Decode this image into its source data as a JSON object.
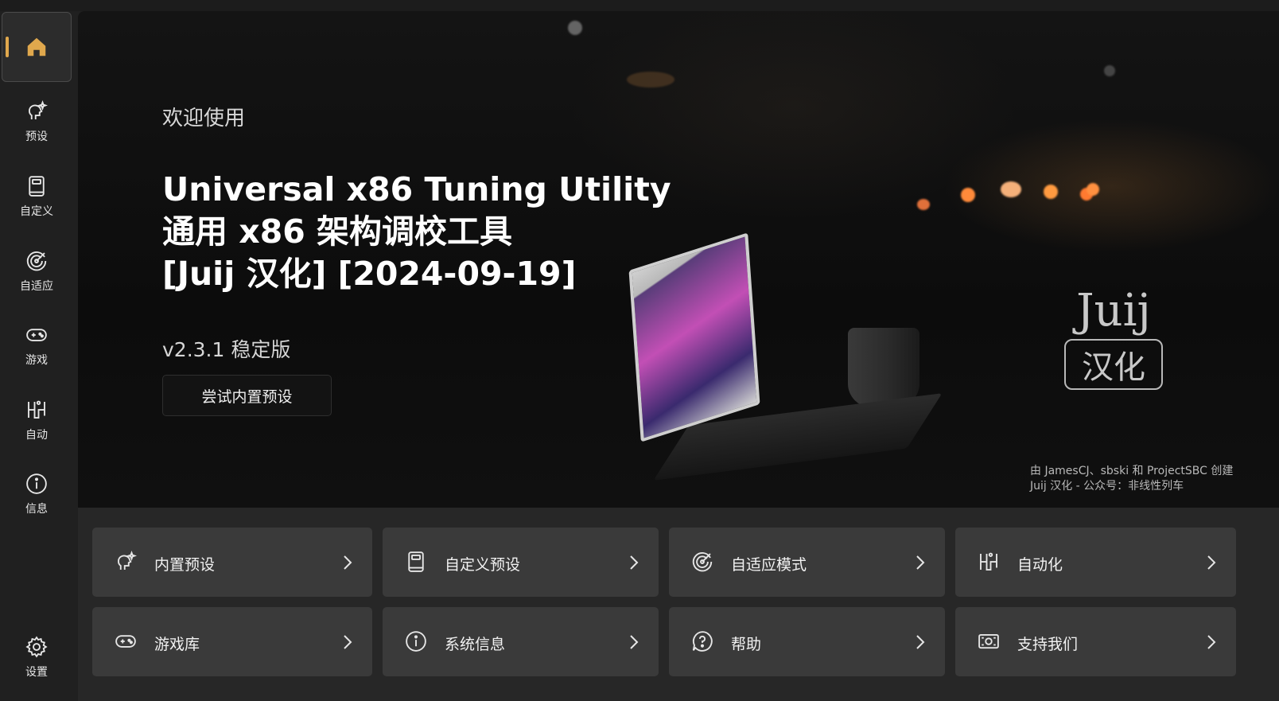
{
  "sidebar": {
    "items": [
      {
        "label": "",
        "icon": "home-icon",
        "active": true
      },
      {
        "label": "预设",
        "icon": "preset-icon"
      },
      {
        "label": "自定义",
        "icon": "book-icon"
      },
      {
        "label": "自适应",
        "icon": "adaptive-icon"
      },
      {
        "label": "游戏",
        "icon": "gamepad-icon"
      },
      {
        "label": "自动",
        "icon": "automation-icon"
      },
      {
        "label": "信息",
        "icon": "info-icon"
      }
    ],
    "settings": {
      "label": "设置",
      "icon": "gear-icon"
    }
  },
  "hero": {
    "welcome": "欢迎使用",
    "title_line1": "Universal x86 Tuning Utility",
    "title_line2": "通用 x86 架构调校工具",
    "title_line3": "[Juij 汉化] [2024-09-19]",
    "version": "v2.3.1 稳定版",
    "try_button": "尝试内置预设",
    "credits_line1": "由 JamesCJ、sbski 和 ProjectSBC 创建",
    "credits_line2": "Juij 汉化 - 公众号：非线性列车",
    "logo_text": "Juij",
    "logo_badge": "汉化"
  },
  "tiles": [
    {
      "label": "内置预设",
      "icon": "preset-icon"
    },
    {
      "label": "自定义预设",
      "icon": "book-icon"
    },
    {
      "label": "自适应模式",
      "icon": "adaptive-icon"
    },
    {
      "label": "自动化",
      "icon": "automation-icon"
    },
    {
      "label": "游戏库",
      "icon": "gamepad-icon"
    },
    {
      "label": "系统信息",
      "icon": "info-icon"
    },
    {
      "label": "帮助",
      "icon": "help-icon"
    },
    {
      "label": "支持我们",
      "icon": "money-icon"
    }
  ],
  "colors": {
    "accent": "#e0a84d",
    "tile_bg": "#3a3a3a",
    "sidebar_bg": "#202020"
  }
}
